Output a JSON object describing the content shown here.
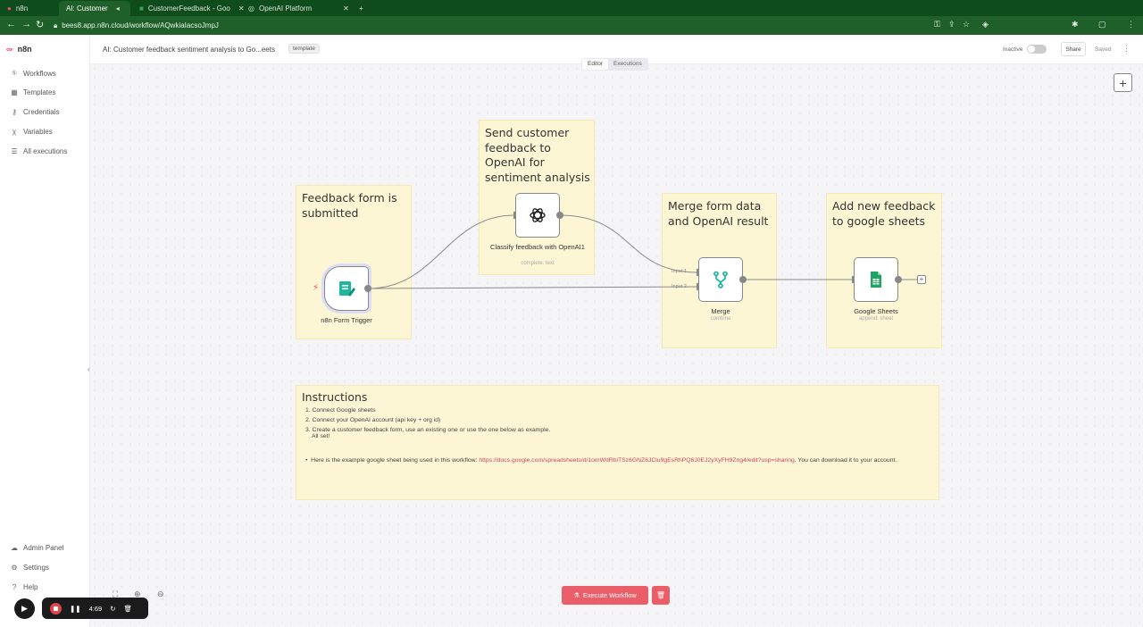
{
  "browser": {
    "tabs": [
      {
        "label": "n8n"
      },
      {
        "label": "AI: Customer"
      },
      {
        "label": "CustomerFeedback - Goo"
      },
      {
        "label": "OpenAI Platform"
      }
    ],
    "url": "bees8.app.n8n.cloud/workflow/AQwkiaIacsoJmpJ"
  },
  "sidebar": {
    "brand": "n8n",
    "items": [
      {
        "label": "Workflows",
        "icon": "network-icon"
      },
      {
        "label": "Templates",
        "icon": "template-icon"
      },
      {
        "label": "Credentials",
        "icon": "key-icon"
      },
      {
        "label": "Variables",
        "icon": "variable-icon"
      },
      {
        "label": "All executions",
        "icon": "list-icon"
      }
    ],
    "bottom": [
      {
        "label": "Admin Panel",
        "icon": "cloud-icon"
      },
      {
        "label": "Settings",
        "icon": "gear-icon"
      },
      {
        "label": "Help",
        "icon": "help-icon"
      }
    ]
  },
  "header": {
    "title": "AI: Customer feedback sentiment analysis to Go...eets",
    "tag": "template",
    "status_label": "Inactive",
    "share": "Share",
    "saved": "Saved"
  },
  "mode": {
    "editor": "Editor",
    "executions": "Executions"
  },
  "stickies": {
    "trigger": "Feedback form is submitted",
    "openai": "Send customer feedback to OpenAI for sentiment analysis",
    "merge": "Merge form data and OpenAI result",
    "sheets": "Add new feedback to google sheets"
  },
  "nodes": {
    "form_trigger": {
      "label": "n8n Form Trigger"
    },
    "openai": {
      "label": "Classify feedback with OpenAI1",
      "sub": "complete: text"
    },
    "merge": {
      "label": "Merge",
      "sub": "combine",
      "input1": "Input 1",
      "input2": "Input 2"
    },
    "sheets": {
      "label": "Google Sheets",
      "sub": "append: sheet"
    }
  },
  "instructions": {
    "title": "Instructions",
    "steps": [
      "1. Connect Google sheets",
      "2. Connect your OpenAI account (api key + org id)",
      "3. Create a customer feedback form, use an existing one or use the one below as example."
    ],
    "all_set": "All set!",
    "bullet_prefix": "Here is the example google sheet being used in this workflow:",
    "link": "https://docs.google.com/spreadsheets/d/1omWdRbiTSz6GNZ6JClu9gEsRhPQ6J0EJ2yXyFH9Zng4/edit?usp=sharing",
    "bullet_suffix": ". You can download it to your account."
  },
  "footer": {
    "execute": "Execute Workflow",
    "timer": "4:69"
  },
  "colors": {
    "accent": "#ea4b71",
    "sticky": "#fdf6d5",
    "execute": "#ea5e6a"
  }
}
